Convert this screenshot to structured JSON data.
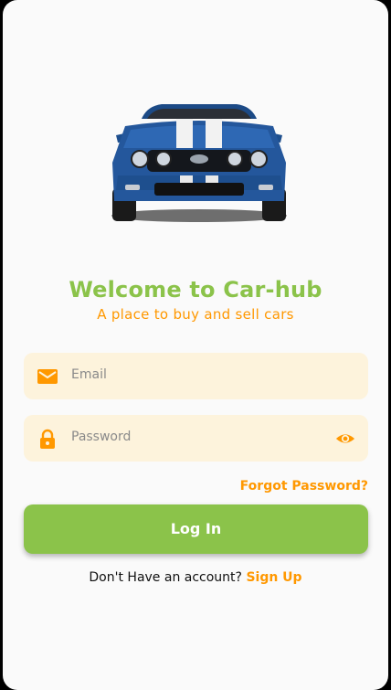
{
  "app": {
    "title": "Welcome to Car-hub",
    "subtitle": "A place to buy and sell cars"
  },
  "hero": {
    "image": "car-image"
  },
  "form": {
    "email_placeholder": "Email",
    "password_placeholder": "Password",
    "email_icon": "mail-icon",
    "password_icon": "lock-icon",
    "visibility_icon": "eye-icon",
    "forgot_label": "Forgot Password?",
    "login_label": "Log In"
  },
  "signup": {
    "prompt": "Don't Have an account?",
    "link_label": "Sign Up"
  },
  "colors": {
    "primary_green": "#8bc34a",
    "accent_orange": "#ff9800",
    "field_bg": "#fdf3dc",
    "background": "#fafafa"
  }
}
